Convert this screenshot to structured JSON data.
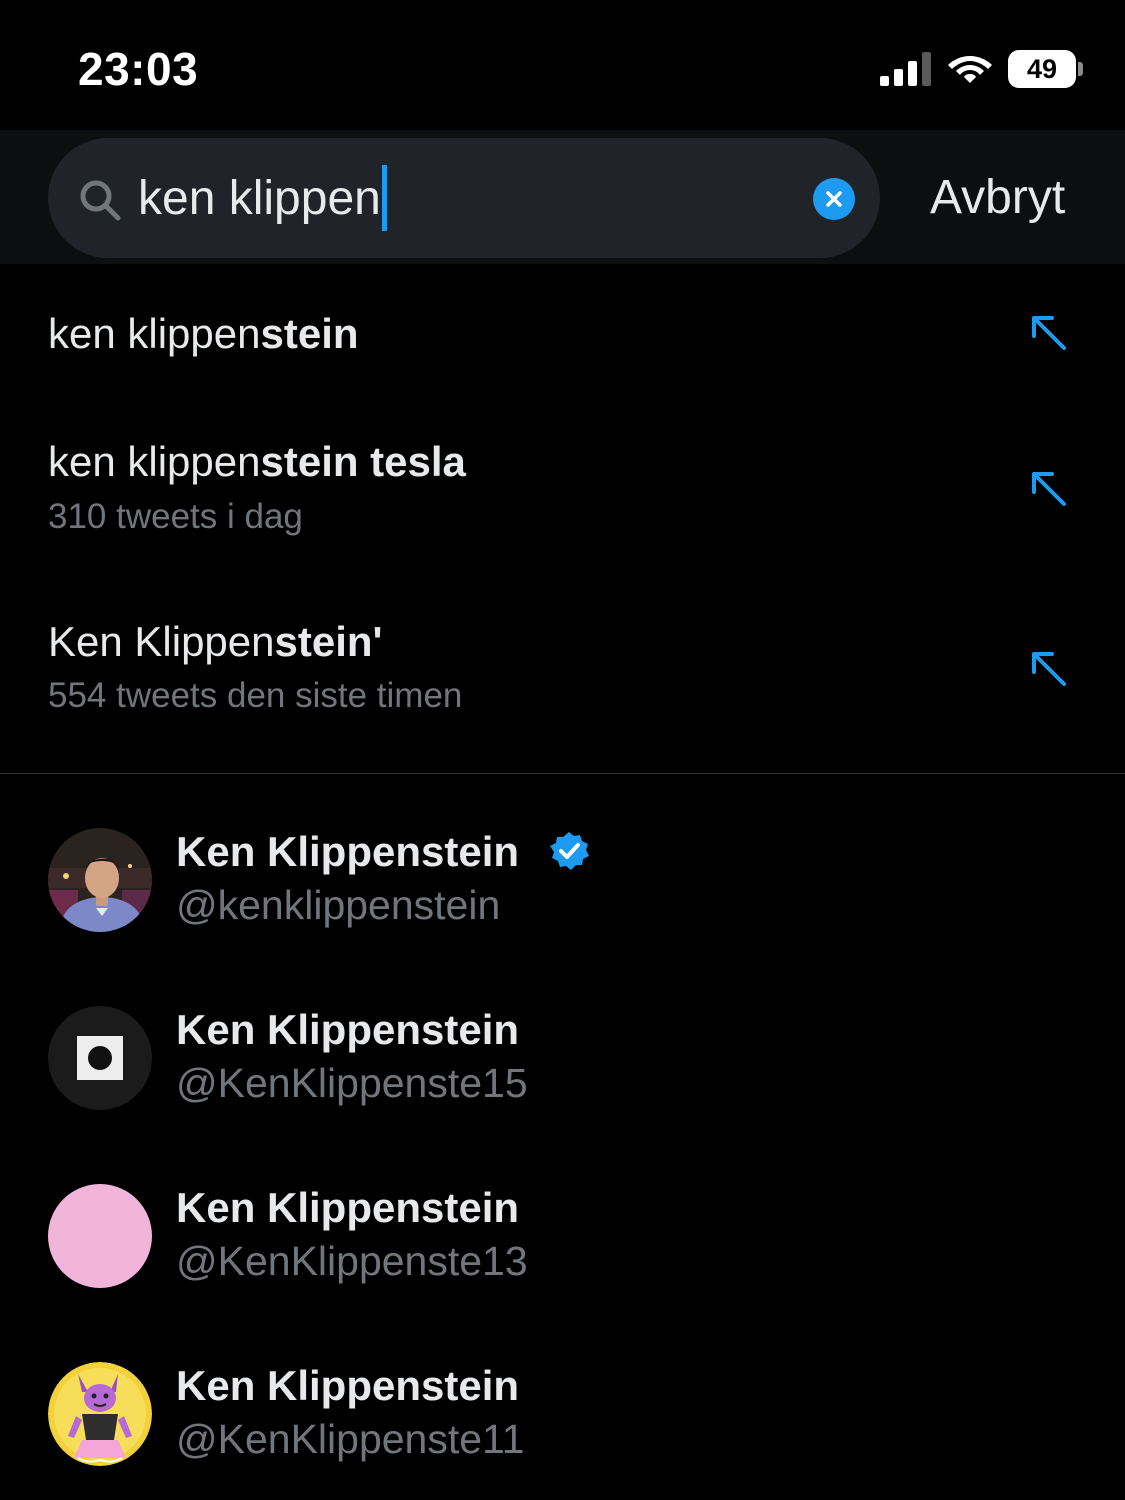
{
  "status_bar": {
    "time": "23:03",
    "battery": "49"
  },
  "search": {
    "query": "ken klippen",
    "cancel_label": "Avbryt"
  },
  "suggestions": [
    {
      "typed": "ken klippen",
      "completion": "stein",
      "subtitle": ""
    },
    {
      "typed": "ken klippen",
      "completion": "stein tesla",
      "subtitle": "310 tweets i dag"
    },
    {
      "typed": "Ken Klippen",
      "completion": "stein'",
      "subtitle": "554 tweets den siste timen"
    }
  ],
  "users": [
    {
      "name": "Ken Klippenstein",
      "handle": "@kenklippenstein",
      "verified": true,
      "avatar": "photo"
    },
    {
      "name": "Ken Klippenstein",
      "handle": "@KenKlippenste15",
      "verified": false,
      "avatar": "square-logo"
    },
    {
      "name": "Ken Klippenstein",
      "handle": "@KenKlippenste13",
      "verified": false,
      "avatar": "pink-circle"
    },
    {
      "name": "Ken Klippenstein",
      "handle": "@KenKlippenste11",
      "verified": false,
      "avatar": "cartoon"
    }
  ],
  "colors": {
    "accent": "#1d9bf0",
    "background": "#000000",
    "secondary_text": "#71767b",
    "pink_avatar": "#f1b5da"
  }
}
